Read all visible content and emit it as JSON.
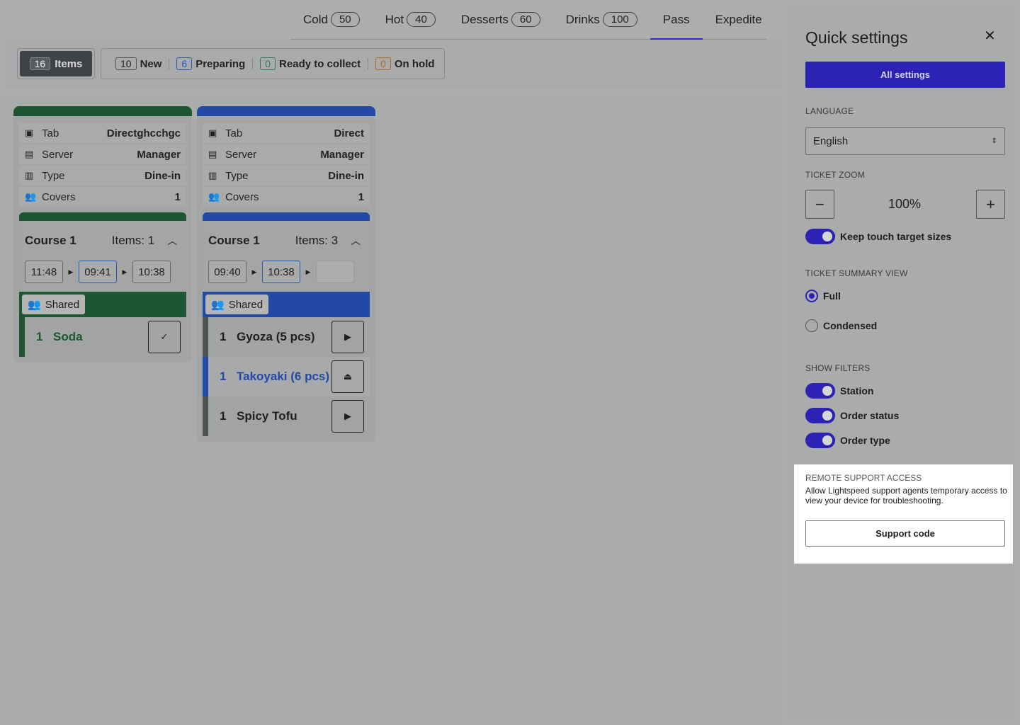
{
  "tabs": [
    {
      "label": "Cold",
      "count": "50"
    },
    {
      "label": "Hot",
      "count": "40"
    },
    {
      "label": "Desserts",
      "count": "60"
    },
    {
      "label": "Drinks",
      "count": "100"
    },
    {
      "label": "Pass",
      "count": ""
    },
    {
      "label": "Expedite",
      "count": ""
    }
  ],
  "active_tab": "Pass",
  "filters": {
    "items": {
      "count": "16",
      "label": "Items"
    },
    "new": {
      "count": "10",
      "label": "New"
    },
    "preparing": {
      "count": "6",
      "label": "Preparing"
    },
    "ready": {
      "count": "0",
      "label": "Ready to collect"
    },
    "hold": {
      "count": "0",
      "label": "On hold"
    }
  },
  "tickets": [
    {
      "color": "#1e5631",
      "tab_label": "Tab",
      "tab_value": "Directghcchgc",
      "server_label": "Server",
      "server_value": "Manager",
      "type_label": "Type",
      "type_value": "Dine-in",
      "covers_label": "Covers",
      "covers_value": "1",
      "course": "Course 1",
      "items_count": "Items: 1",
      "times": [
        "11:48",
        "09:41",
        "10:38"
      ],
      "shared": "Shared",
      "items": [
        {
          "qty": "1",
          "name": "Soda",
          "action": "check-icon"
        }
      ]
    },
    {
      "color": "#2349a6",
      "tab_label": "Tab",
      "tab_value": "Direct",
      "server_label": "Server",
      "server_value": "Manager",
      "type_label": "Type",
      "type_value": "Dine-in",
      "covers_label": "Covers",
      "covers_value": "1",
      "course": "Course 1",
      "items_count": "Items: 3",
      "times": [
        "09:40",
        "10:38",
        ""
      ],
      "shared": "Shared",
      "items": [
        {
          "qty": "1",
          "name": "Gyoza (5 pcs)",
          "action": "play-icon"
        },
        {
          "qty": "1",
          "name": "Takoyaki (6 pcs)",
          "action": "cloche-icon"
        },
        {
          "qty": "1",
          "name": "Spicy Tofu",
          "action": "play-icon"
        }
      ]
    }
  ],
  "panel": {
    "title": "Quick settings",
    "all_settings": "All settings",
    "language_label": "LANGUAGE",
    "language_value": "English",
    "zoom_label": "TICKET ZOOM",
    "zoom_value": "100%",
    "zoom_minus": "−",
    "zoom_plus": "+",
    "touch_label": "Keep touch target sizes",
    "summary_label": "TICKET SUMMARY VIEW",
    "summary_full": "Full",
    "summary_condensed": "Condensed",
    "filters_label": "SHOW FILTERS",
    "filter_station": "Station",
    "filter_status": "Order status",
    "filter_type": "Order type",
    "remote_label": "REMOTE SUPPORT ACCESS",
    "remote_desc": "Allow Lightspeed support agents temporary access to view your device for troubleshooting.",
    "support_button": "Support code"
  },
  "colors": {
    "accent": "#2c22b3",
    "ticket1": "#1e5631",
    "ticket2": "#2349a6"
  }
}
